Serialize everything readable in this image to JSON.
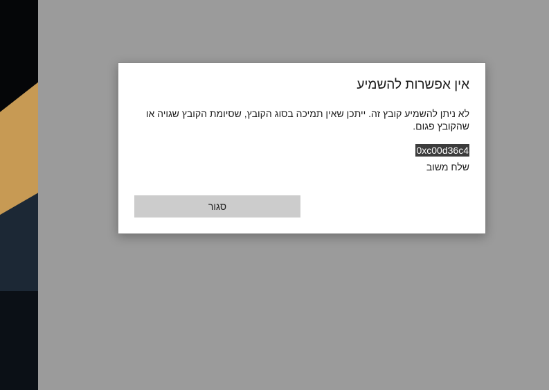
{
  "dialog": {
    "title": "אין אפשרות להשמיע",
    "message": "לא ניתן להשמיע קובץ זה. ייתכן שאין תמיכה בסוג הקובץ, שסיומת הקובץ שגויה או שהקובץ פגום.",
    "error_code": "0xc00d36c4",
    "feedback_label": "שלח משוב",
    "close_label": "סגור"
  },
  "colors": {
    "overlay": "#9b9b9b",
    "dialog_background": "#ffffff",
    "button_background": "#cccccc",
    "error_code_highlight": "#3c3c3c"
  }
}
